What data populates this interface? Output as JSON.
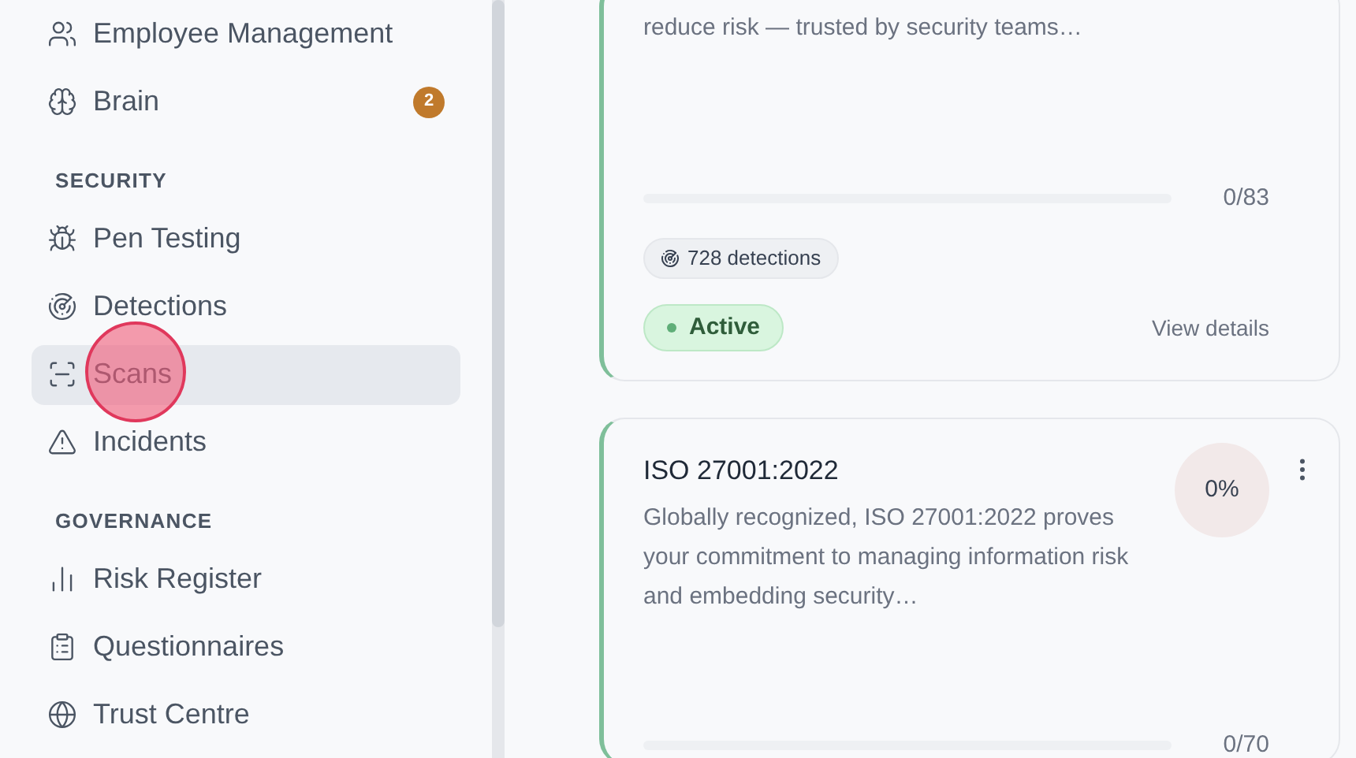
{
  "sidebar": {
    "sections": [
      {
        "items": [
          {
            "label": "Employee Management",
            "selected": false
          },
          {
            "label": "Brain",
            "badge": "2",
            "selected": false
          }
        ]
      },
      {
        "title": "SECURITY",
        "items": [
          {
            "label": "Pen Testing",
            "selected": false
          },
          {
            "label": "Detections",
            "selected": false
          },
          {
            "label": "Scans",
            "selected": true
          },
          {
            "label": "Incidents",
            "selected": false
          }
        ]
      },
      {
        "title": "GOVERNANCE",
        "items": [
          {
            "label": "Risk Register",
            "selected": false
          },
          {
            "label": "Questionnaires",
            "selected": false
          },
          {
            "label": "Trust Centre",
            "selected": false
          }
        ]
      }
    ]
  },
  "cards": [
    {
      "description": "reduce risk — trusted by security teams…",
      "progress": {
        "level": 0,
        "count": "0/83"
      },
      "detections": "728 detections",
      "status": {
        "label": "Active",
        "active": true
      },
      "link": "View details"
    },
    {
      "title": "ISO 27001:2022",
      "description": "Globally recognized, ISO 27001:2022 proves your commitment to managing information risk and embedding security…",
      "percent": "0%",
      "progress": {
        "level": 0,
        "count": "0/70"
      }
    }
  ]
}
